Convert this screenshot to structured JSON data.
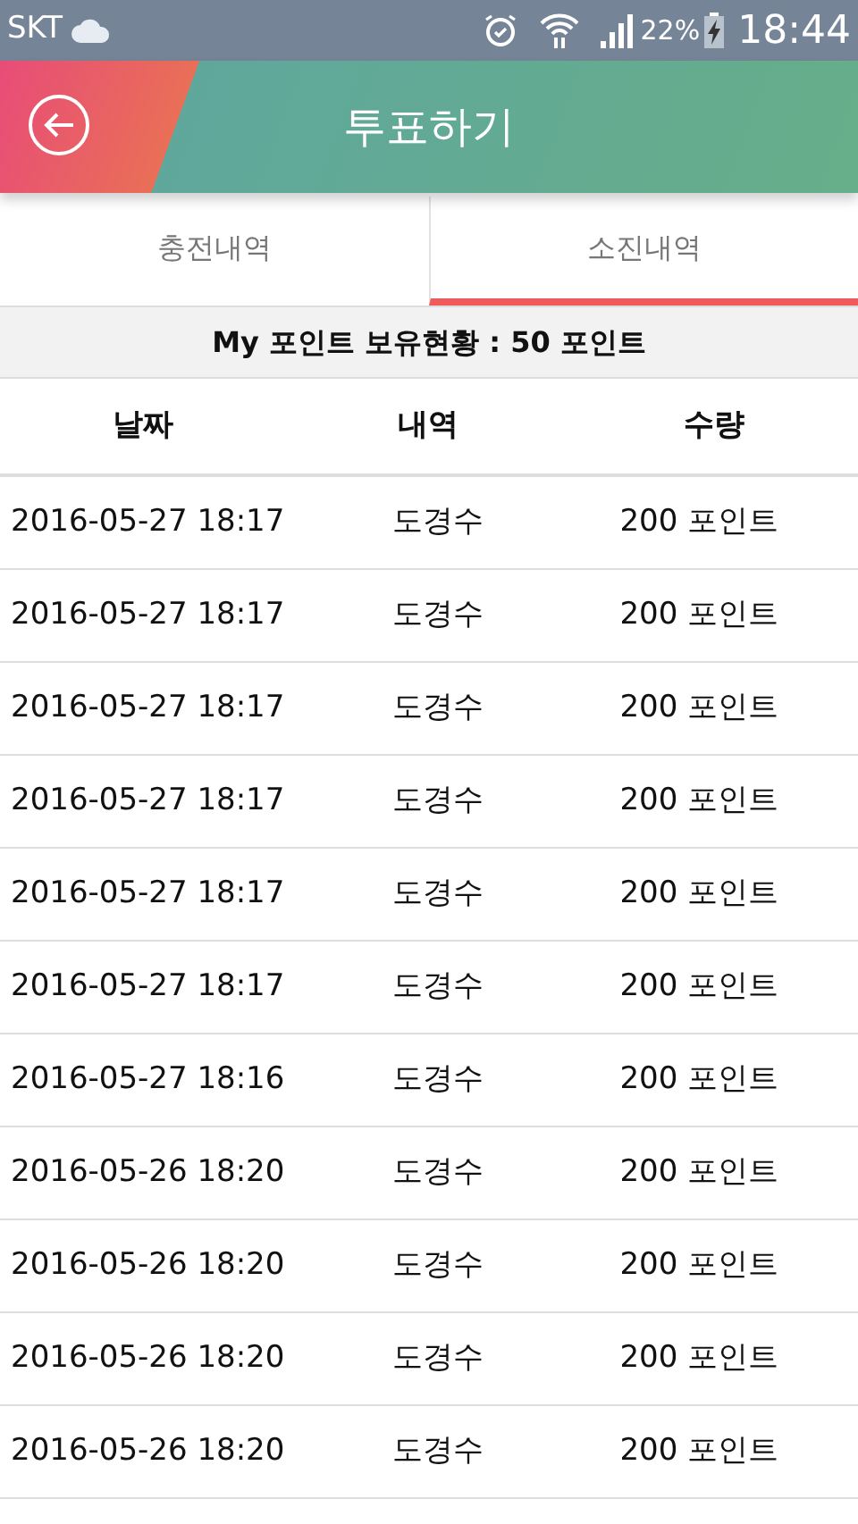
{
  "status_bar": {
    "carrier": "SKT",
    "battery": "22%",
    "time": "18:44"
  },
  "header": {
    "title": "투표하기"
  },
  "tabs": [
    {
      "label": "충전내역",
      "selected": false
    },
    {
      "label": "소진내역",
      "selected": true
    }
  ],
  "summary": "My 포인트 보유현황 : 50 포인트",
  "table": {
    "columns": [
      "날짜",
      "내역",
      "수량"
    ],
    "rows": [
      [
        "2016-05-27 18:17",
        "도경수",
        "200 포인트"
      ],
      [
        "2016-05-27 18:17",
        "도경수",
        "200 포인트"
      ],
      [
        "2016-05-27 18:17",
        "도경수",
        "200 포인트"
      ],
      [
        "2016-05-27 18:17",
        "도경수",
        "200 포인트"
      ],
      [
        "2016-05-27 18:17",
        "도경수",
        "200 포인트"
      ],
      [
        "2016-05-27 18:17",
        "도경수",
        "200 포인트"
      ],
      [
        "2016-05-27 18:16",
        "도경수",
        "200 포인트"
      ],
      [
        "2016-05-26 18:20",
        "도경수",
        "200 포인트"
      ],
      [
        "2016-05-26 18:20",
        "도경수",
        "200 포인트"
      ],
      [
        "2016-05-26 18:20",
        "도경수",
        "200 포인트"
      ],
      [
        "2016-05-26 18:20",
        "도경수",
        "200 포인트"
      ]
    ]
  }
}
